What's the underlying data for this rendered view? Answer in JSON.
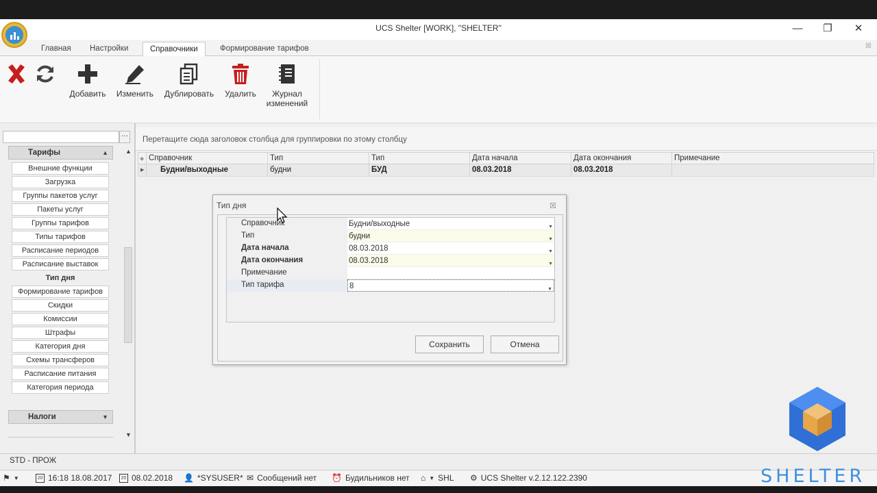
{
  "window": {
    "title": "UCS Shelter [WORK], \"SHELTER\"",
    "minimize": "—",
    "restore": "❐",
    "close": "✕"
  },
  "tabs": [
    {
      "label": "Главная"
    },
    {
      "label": "Настройки"
    },
    {
      "label": "Справочники",
      "active": true
    },
    {
      "label": "Формирование тарифов"
    }
  ],
  "ribbon_close": "☒",
  "ribbon": {
    "add": "Добавить",
    "edit": "Изменить",
    "duplicate": "Дублировать",
    "delete": "Удалить",
    "journal_line1": "Журнал",
    "journal_line2": "изменений"
  },
  "left_panel": {
    "search_button": "···",
    "group_tariffs": "Тарифы",
    "items": [
      "Внешние функции",
      "Загрузка",
      "Группы пакетов услуг",
      "Пакеты услуг",
      "Группы тарифов",
      "Типы тарифов",
      "Расписание периодов",
      "Расписание выставок",
      "Тип дня",
      "Формирование тарифов",
      "Скидки",
      "Комиссии",
      "Штрафы",
      "Категория дня",
      "Схемы трансферов",
      "Расписание питания",
      "Категория периода"
    ],
    "selected_item": "Тип дня",
    "group_taxes": "Налоги"
  },
  "grid": {
    "group_hint": "Перетащите сюда заголовок столбца для группировки по этому столбцу",
    "columns": [
      "Справочник",
      "Тип",
      "Тип",
      "Дата начала",
      "Дата окончания",
      "Примечание"
    ],
    "rows": [
      [
        "Будни/выходные",
        "будни",
        "БУД",
        "08.03.2018",
        "08.03.2018",
        ""
      ]
    ]
  },
  "dialog": {
    "title": "Тип дня",
    "fields": [
      {
        "label": "Справочник",
        "value": "Будни/выходные"
      },
      {
        "label": "Тип",
        "value": "будни"
      },
      {
        "label": "Дата начала",
        "value": "08.03.2018"
      },
      {
        "label": "Дата окончания",
        "value": "08.03.2018"
      },
      {
        "label": "Примечание",
        "value": ""
      },
      {
        "label": "Тип тарифа",
        "value": "8"
      }
    ],
    "save": "Сохранить",
    "cancel": "Отмена"
  },
  "std_label": "STD - ПРОЖ",
  "status": {
    "datetime": "16:18 18.08.2017",
    "work_date": "08.02.2018",
    "user": "*SYSUSER*",
    "messages": "Сообщений нет",
    "alarms": "Будильников нет",
    "home": "SHL",
    "version": "UCS Shelter v.2.12.122.2390"
  },
  "brand": {
    "name": "SHELTER"
  },
  "colors": {
    "accent_red": "#c81d1d",
    "brand_blue": "#3e8fe0",
    "logo_orange": "#e8a64a"
  }
}
